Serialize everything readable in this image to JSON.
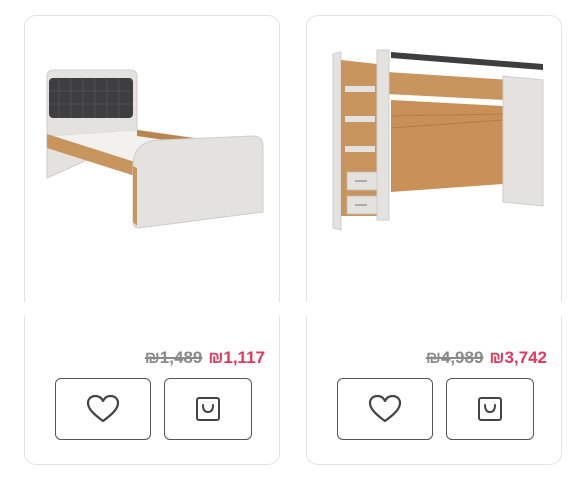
{
  "products": [
    {
      "old_price": "₪1,489",
      "new_price": "₪1,117",
      "image_icon": "single-bed-image",
      "favorite_icon": "heart-icon",
      "cart_icon": "shopping-bag-icon"
    },
    {
      "old_price": "₪4,989",
      "new_price": "₪3,742",
      "image_icon": "loft-bed-with-stairs-image",
      "favorite_icon": "heart-icon",
      "cart_icon": "shopping-bag-icon"
    }
  ],
  "colors": {
    "sale_price": "#e2375d",
    "old_price": "#8a8a8a",
    "wood": "#c9955e",
    "panel_white": "#e4e2df",
    "headboard_dark": "#3e3e40",
    "border": "#e3e3e3"
  }
}
